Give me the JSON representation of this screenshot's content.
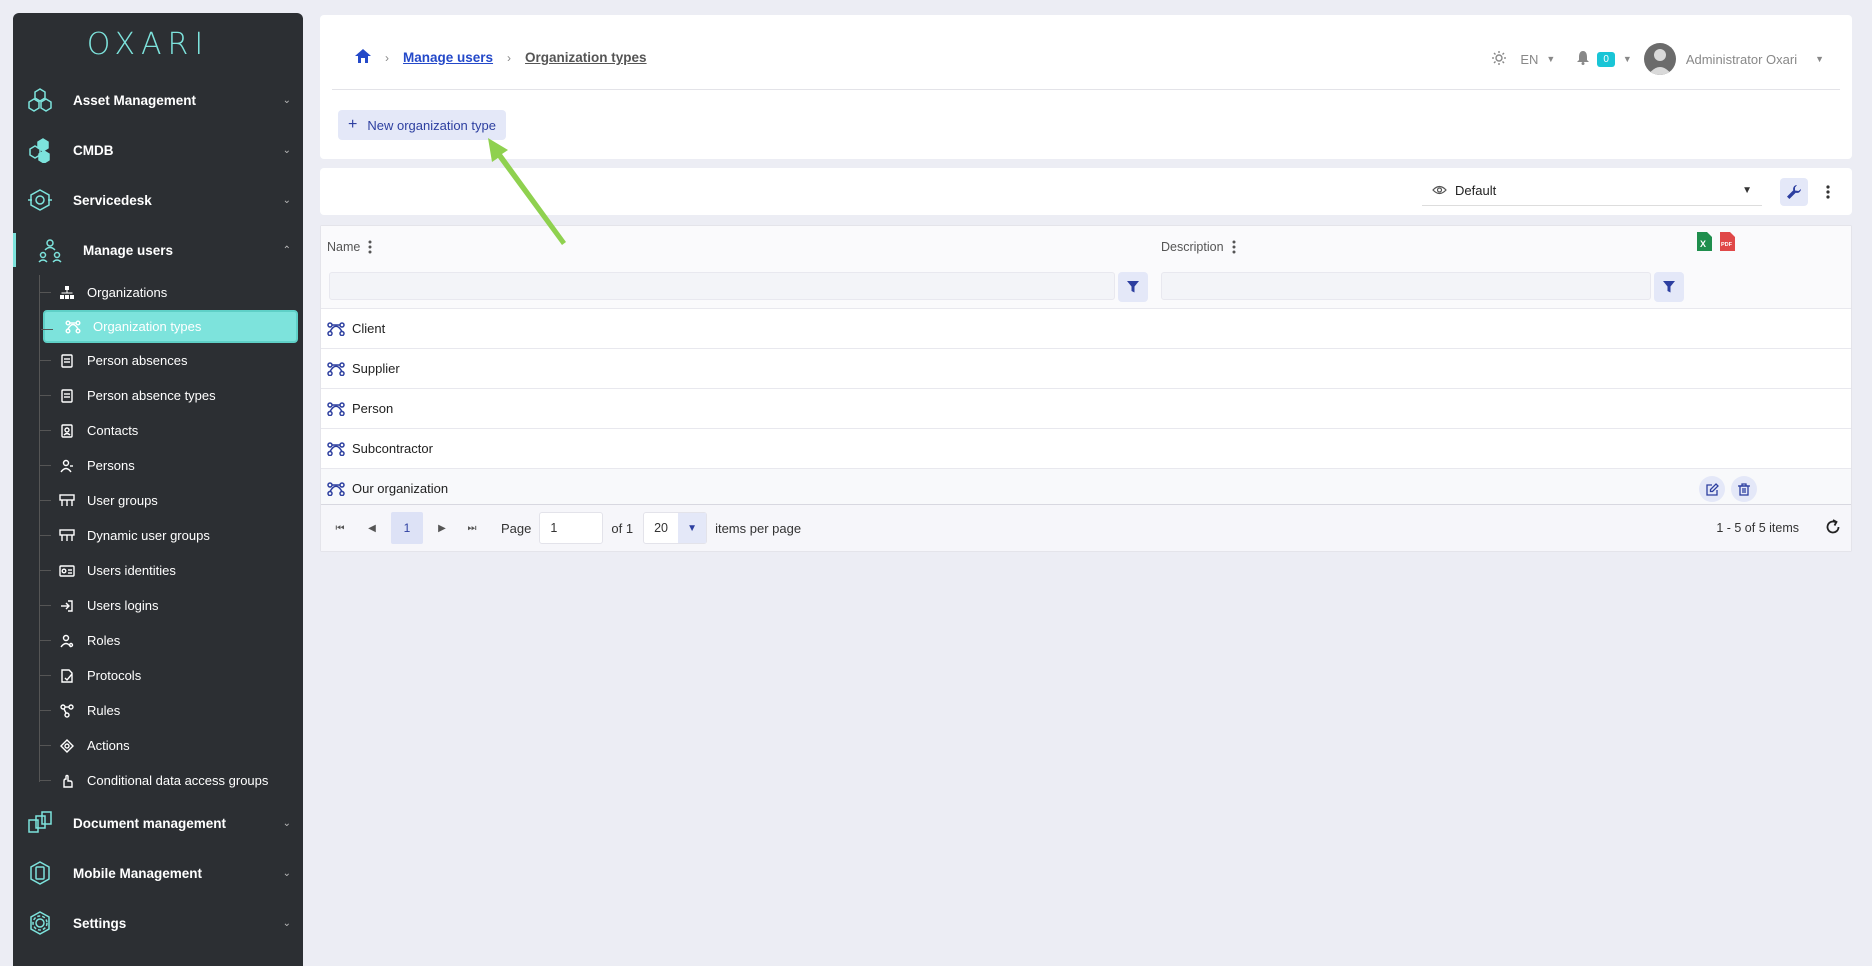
{
  "app": {
    "logo": "OXARI"
  },
  "sidebar": {
    "sections_top": [
      {
        "label": "Asset Management",
        "icon": "asset-management-icon"
      },
      {
        "label": "CMDB",
        "icon": "cmdb-icon"
      },
      {
        "label": "Servicedesk",
        "icon": "servicedesk-icon"
      }
    ],
    "open_section": {
      "label": "Manage users",
      "icon": "manage-users-icon"
    },
    "sub_items": [
      {
        "label": "Organizations",
        "icon": "organizations-icon"
      },
      {
        "label": "Organization types",
        "icon": "organization-types-icon",
        "active": true
      },
      {
        "label": "Person absences",
        "icon": "person-absences-icon"
      },
      {
        "label": "Person absence types",
        "icon": "person-absence-types-icon"
      },
      {
        "label": "Contacts",
        "icon": "contacts-icon"
      },
      {
        "label": "Persons",
        "icon": "persons-icon"
      },
      {
        "label": "User groups",
        "icon": "user-groups-icon"
      },
      {
        "label": "Dynamic user groups",
        "icon": "dynamic-user-groups-icon"
      },
      {
        "label": "Users identities",
        "icon": "users-identities-icon"
      },
      {
        "label": "Users logins",
        "icon": "users-logins-icon"
      },
      {
        "label": "Roles",
        "icon": "roles-icon"
      },
      {
        "label": "Protocols",
        "icon": "protocols-icon"
      },
      {
        "label": "Rules",
        "icon": "rules-icon"
      },
      {
        "label": "Actions",
        "icon": "actions-icon"
      },
      {
        "label": "Conditional data access groups",
        "icon": "conditional-access-icon"
      }
    ],
    "sections_bottom": [
      {
        "label": "Document management",
        "icon": "document-management-icon"
      },
      {
        "label": "Mobile Management",
        "icon": "mobile-management-icon"
      },
      {
        "label": "Settings",
        "icon": "settings-icon"
      }
    ]
  },
  "header": {
    "breadcrumb": {
      "link": "Manage users",
      "current": "Organization types"
    },
    "language": "EN",
    "notifications_count": "0",
    "user_name": "Administrator Oxari",
    "new_button_label": "New organization type"
  },
  "toolbar": {
    "view_label": "Default"
  },
  "grid": {
    "columns": {
      "name": "Name",
      "description": "Description"
    },
    "rows": [
      {
        "name": "Client",
        "description": ""
      },
      {
        "name": "Supplier",
        "description": ""
      },
      {
        "name": "Person",
        "description": ""
      },
      {
        "name": "Subcontractor",
        "description": ""
      },
      {
        "name": "Our organization",
        "description": ""
      }
    ]
  },
  "pager": {
    "current_page": "1",
    "page_label": "Page",
    "page_input": "1",
    "of_label": "of 1",
    "page_size": "20",
    "items_per_page_label": "items per page",
    "info": "1 - 5 of 5 items"
  },
  "colors": {
    "accent": "#7de3dc",
    "primary": "#2d3fa0",
    "sidebar": "#2c2f33"
  }
}
